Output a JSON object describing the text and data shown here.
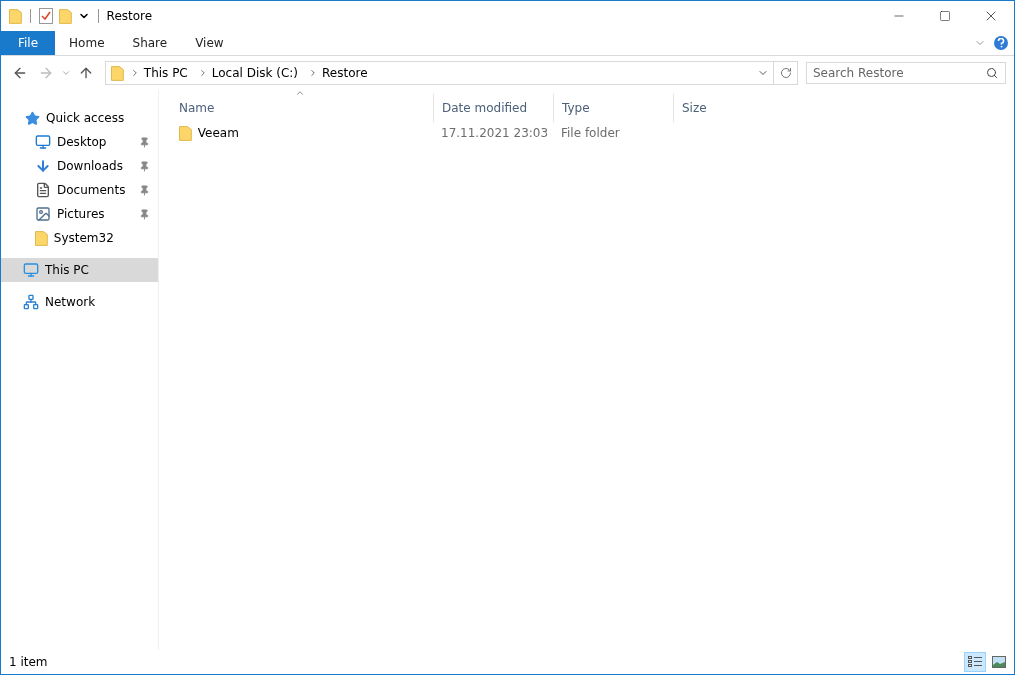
{
  "window": {
    "title": "Restore"
  },
  "tabs": [
    {
      "label": "File",
      "selected": true,
      "kind": "file"
    },
    {
      "label": "Home",
      "selected": false,
      "kind": "tab"
    },
    {
      "label": "Share",
      "selected": false,
      "kind": "tab"
    },
    {
      "label": "View",
      "selected": false,
      "kind": "tab"
    }
  ],
  "breadcrumb": [
    "This PC",
    "Local Disk (C:)",
    "Restore"
  ],
  "search": {
    "placeholder": "Search Restore"
  },
  "sidebar": {
    "items": [
      {
        "label": "Quick access",
        "kind": "star",
        "selected": false,
        "children": [
          {
            "label": "Desktop",
            "kind": "desktop",
            "pinned": true,
            "selected": false
          },
          {
            "label": "Downloads",
            "kind": "download",
            "pinned": true,
            "selected": false
          },
          {
            "label": "Documents",
            "kind": "document",
            "pinned": true,
            "selected": false
          },
          {
            "label": "Pictures",
            "kind": "picture",
            "pinned": true,
            "selected": false
          },
          {
            "label": "System32",
            "kind": "folder",
            "pinned": false,
            "selected": false
          }
        ]
      },
      {
        "label": "This PC",
        "kind": "pc",
        "selected": true
      },
      {
        "label": "Network",
        "kind": "network",
        "selected": false
      }
    ]
  },
  "table": {
    "columns": [
      "Name",
      "Date modified",
      "Type",
      "Size"
    ],
    "rows": [
      {
        "name": "Veeam",
        "date": "17.11.2021 23:03",
        "type": "File folder",
        "size": ""
      }
    ]
  },
  "status_bar": {
    "text": "1 item",
    "views": [
      {
        "kind": "details",
        "selected": true
      },
      {
        "kind": "thumbnails",
        "selected": false
      }
    ]
  }
}
